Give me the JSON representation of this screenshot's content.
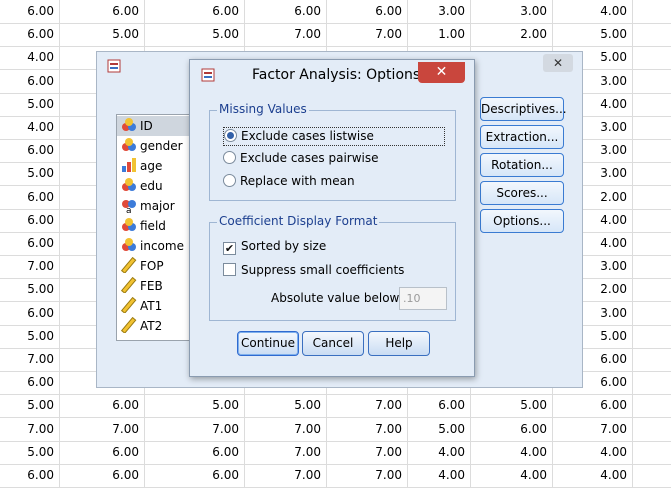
{
  "grid_rows": [
    [
      "6.00",
      "6.00",
      "6.00",
      "6.00",
      "6.00",
      "3.00",
      "3.00",
      "4.00"
    ],
    [
      "6.00",
      "5.00",
      "5.00",
      "7.00",
      "7.00",
      "1.00",
      "2.00",
      "5.00"
    ],
    [
      "4.00",
      "",
      "",
      "",
      "",
      "",
      "",
      "5.00"
    ],
    [
      "6.00",
      "",
      "",
      "",
      "",
      "",
      "",
      "3.00"
    ],
    [
      "5.00",
      "",
      "",
      "",
      "",
      "",
      "",
      "4.00"
    ],
    [
      "4.00",
      "",
      "",
      "",
      "",
      "",
      "",
      "3.00"
    ],
    [
      "6.00",
      "",
      "",
      "",
      "",
      "",
      "",
      "3.00"
    ],
    [
      "5.00",
      "",
      "",
      "",
      "",
      "",
      "",
      "3.00"
    ],
    [
      "6.00",
      "",
      "",
      "",
      "",
      "",
      "",
      "2.00"
    ],
    [
      "6.00",
      "",
      "",
      "",
      "",
      "",
      "",
      "4.00"
    ],
    [
      "6.00",
      "",
      "",
      "",
      "",
      "",
      "",
      "4.00"
    ],
    [
      "7.00",
      "",
      "",
      "",
      "",
      "",
      "",
      "3.00"
    ],
    [
      "5.00",
      "",
      "",
      "",
      "",
      "",
      "",
      "2.00"
    ],
    [
      "6.00",
      "",
      "",
      "",
      "",
      "",
      "",
      "3.00"
    ],
    [
      "5.00",
      "",
      "",
      "",
      "",
      "",
      "",
      "5.00"
    ],
    [
      "7.00",
      "",
      "",
      "",
      "",
      "",
      "",
      "6.00"
    ],
    [
      "6.00",
      "",
      "",
      "",
      "",
      "",
      "",
      "6.00"
    ],
    [
      "5.00",
      "6.00",
      "5.00",
      "5.00",
      "7.00",
      "6.00",
      "5.00",
      "6.00"
    ],
    [
      "7.00",
      "7.00",
      "7.00",
      "7.00",
      "7.00",
      "5.00",
      "6.00",
      "7.00"
    ],
    [
      "5.00",
      "6.00",
      "6.00",
      "7.00",
      "7.00",
      "4.00",
      "4.00",
      "4.00"
    ],
    [
      "6.00",
      "6.00",
      "6.00",
      "7.00",
      "7.00",
      "4.00",
      "4.00",
      "4.00"
    ]
  ],
  "factor_dialog": {
    "variables": [
      {
        "label": "ID",
        "icon": "nominal-variable-icon"
      },
      {
        "label": "gender",
        "icon": "nominal-variable-icon"
      },
      {
        "label": "age",
        "icon": "ordinal-variable-icon"
      },
      {
        "label": "edu",
        "icon": "nominal-variable-icon"
      },
      {
        "label": "major",
        "icon": "string-variable-icon"
      },
      {
        "label": "field",
        "icon": "nominal-variable-icon"
      },
      {
        "label": "income",
        "icon": "nominal-variable-icon"
      },
      {
        "label": "FOP",
        "icon": "scale-variable-icon"
      },
      {
        "label": "FEB",
        "icon": "scale-variable-icon"
      },
      {
        "label": "AT1",
        "icon": "scale-variable-icon"
      },
      {
        "label": "AT2",
        "icon": "scale-variable-icon"
      }
    ],
    "buttons": {
      "descriptives": "Descriptives...",
      "extraction": "Extraction...",
      "rotation": "Rotation...",
      "scores": "Scores...",
      "options": "Options..."
    },
    "close_label": "✕"
  },
  "options_dialog": {
    "title": "Factor Analysis: Options",
    "close_label": "✕",
    "missing_values": {
      "label": "Missing Values",
      "options": [
        {
          "label": "Exclude cases listwise",
          "selected": true
        },
        {
          "label": "Exclude cases pairwise",
          "selected": false
        },
        {
          "label": "Replace with mean",
          "selected": false
        }
      ]
    },
    "coefficient_format": {
      "label": "Coefficient Display Format",
      "sorted_by_size": {
        "label": "Sorted by size",
        "checked": true
      },
      "suppress_small": {
        "label": "Suppress small coefficients",
        "checked": false
      },
      "absolute_value_label": "Absolute value below:",
      "absolute_value": ".10"
    },
    "buttons": {
      "continue": "Continue",
      "cancel": "Cancel",
      "help": "Help"
    }
  },
  "colors": {
    "dialog_bg": "#e3ecf7",
    "close_red": "#c9463d",
    "group_label": "#1c3f8f",
    "button_border": "#3a6fc0"
  }
}
